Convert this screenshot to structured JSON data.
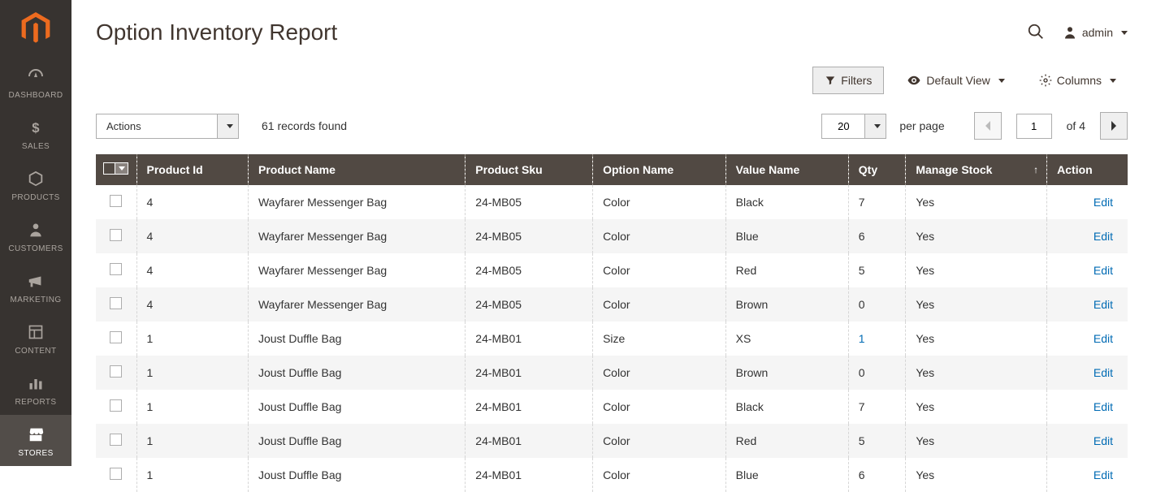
{
  "page_title": "Option Inventory Report",
  "user": {
    "name": "admin"
  },
  "sidebar": {
    "items": [
      {
        "label": "DASHBOARD"
      },
      {
        "label": "SALES"
      },
      {
        "label": "PRODUCTS"
      },
      {
        "label": "CUSTOMERS"
      },
      {
        "label": "MARKETING"
      },
      {
        "label": "CONTENT"
      },
      {
        "label": "REPORTS"
      },
      {
        "label": "STORES"
      }
    ]
  },
  "toolbar": {
    "filters": "Filters",
    "default_view": "Default View",
    "columns": "Columns"
  },
  "controls": {
    "actions_label": "Actions",
    "records_found": "61 records found",
    "per_page_value": "20",
    "per_page_label": "per page",
    "current_page": "1",
    "page_of": "of 4"
  },
  "table": {
    "headers": {
      "product_id": "Product Id",
      "product_name": "Product Name",
      "product_sku": "Product Sku",
      "option_name": "Option Name",
      "value_name": "Value Name",
      "qty": "Qty",
      "manage_stock": "Manage Stock",
      "action": "Action"
    },
    "edit_label": "Edit",
    "rows": [
      {
        "product_id": "4",
        "product_name": "Wayfarer Messenger Bag",
        "product_sku": "24-MB05",
        "option_name": "Color",
        "value_name": "Black",
        "qty": "7",
        "qty_link": false,
        "manage_stock": "Yes"
      },
      {
        "product_id": "4",
        "product_name": "Wayfarer Messenger Bag",
        "product_sku": "24-MB05",
        "option_name": "Color",
        "value_name": "Blue",
        "qty": "6",
        "qty_link": false,
        "manage_stock": "Yes"
      },
      {
        "product_id": "4",
        "product_name": "Wayfarer Messenger Bag",
        "product_sku": "24-MB05",
        "option_name": "Color",
        "value_name": "Red",
        "qty": "5",
        "qty_link": false,
        "manage_stock": "Yes"
      },
      {
        "product_id": "4",
        "product_name": "Wayfarer Messenger Bag",
        "product_sku": "24-MB05",
        "option_name": "Color",
        "value_name": "Brown",
        "qty": "0",
        "qty_link": false,
        "manage_stock": "Yes"
      },
      {
        "product_id": "1",
        "product_name": "Joust Duffle Bag",
        "product_sku": "24-MB01",
        "option_name": "Size",
        "value_name": "XS",
        "qty": "1",
        "qty_link": true,
        "manage_stock": "Yes"
      },
      {
        "product_id": "1",
        "product_name": "Joust Duffle Bag",
        "product_sku": "24-MB01",
        "option_name": "Color",
        "value_name": "Brown",
        "qty": "0",
        "qty_link": false,
        "manage_stock": "Yes"
      },
      {
        "product_id": "1",
        "product_name": "Joust Duffle Bag",
        "product_sku": "24-MB01",
        "option_name": "Color",
        "value_name": "Black",
        "qty": "7",
        "qty_link": false,
        "manage_stock": "Yes"
      },
      {
        "product_id": "1",
        "product_name": "Joust Duffle Bag",
        "product_sku": "24-MB01",
        "option_name": "Color",
        "value_name": "Red",
        "qty": "5",
        "qty_link": false,
        "manage_stock": "Yes"
      },
      {
        "product_id": "1",
        "product_name": "Joust Duffle Bag",
        "product_sku": "24-MB01",
        "option_name": "Color",
        "value_name": "Blue",
        "qty": "6",
        "qty_link": false,
        "manage_stock": "Yes"
      }
    ]
  }
}
